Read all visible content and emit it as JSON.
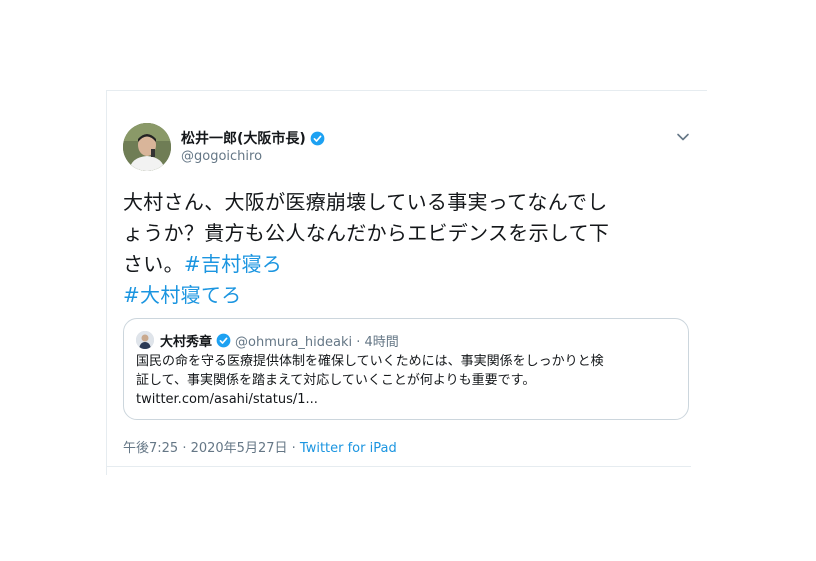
{
  "tweet": {
    "display_name": "松井一郎(大阪市長)",
    "handle": "@gogoichiro",
    "body_line1": "大村さん、大阪が医療崩壊している事実ってなんでし",
    "body_line2": "ょうか？貴方も公人なんだからエビデンスを示して下",
    "body_line3": "さい。",
    "hashtag1": "#吉村寝ろ",
    "hashtag2": "#大村寝てろ",
    "timestamp": "午後7:25 · 2020年5月27日",
    "separator": " · ",
    "source": "Twitter for iPad"
  },
  "quoted": {
    "display_name": "大村秀章",
    "handle_meta": "@ohmura_hideaki · 4時間",
    "text_line1": "国民の命を守る医療提供体制を確保していくためには、事実関係をしっかりと検",
    "text_line2": "証して、事実関係を踏まえて対応していくことが何よりも重要です。",
    "link": "twitter.com/asahi/status/1..."
  },
  "colors": {
    "link": "#1b95e0",
    "verified": "#1da1f2",
    "secondary_text": "#657786",
    "border": "#ccd6dd"
  },
  "icons": [
    "avatar",
    "verified-badge-icon",
    "chevron-down-icon"
  ]
}
